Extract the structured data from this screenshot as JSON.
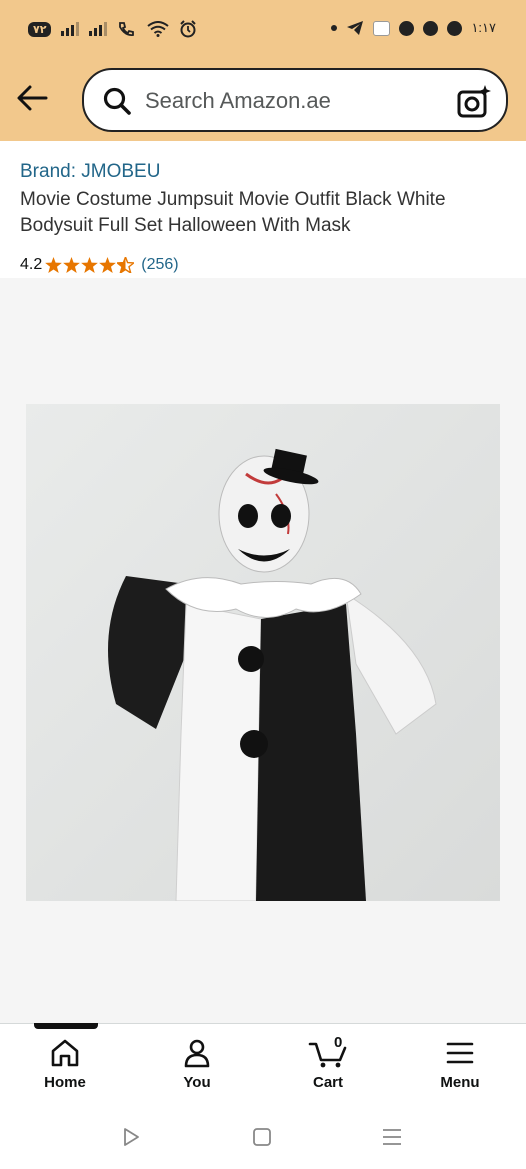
{
  "status_bar": {
    "battery": "٧٢",
    "time": "١:١٧"
  },
  "search": {
    "placeholder": "Search Amazon.ae"
  },
  "product": {
    "brand": "Brand: JMOBEU",
    "title": "Movie Costume Jumpsuit Movie Outfit Black White Bodysuit Full Set Halloween With Mask",
    "rating_value": "4.2",
    "rating_stars": 4.2,
    "review_count": "(256)"
  },
  "bottom_nav": {
    "home": "Home",
    "you": "You",
    "cart": "Cart",
    "cart_count": "0",
    "menu": "Menu"
  },
  "colors": {
    "header_bg": "#f2c88c",
    "link": "#226689",
    "star": "#e77600"
  }
}
